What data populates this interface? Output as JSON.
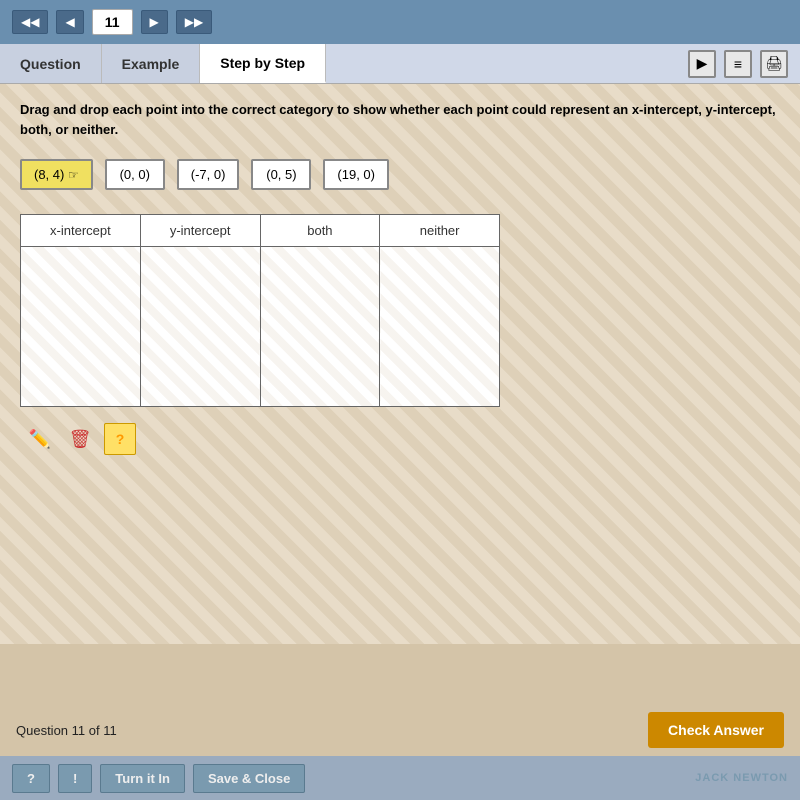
{
  "nav": {
    "back_double_label": "◀◀",
    "back_label": "◀",
    "question_number": "11",
    "forward_label": "▶",
    "forward_double_label": "▶▶"
  },
  "tabs": [
    {
      "id": "question",
      "label": "Question",
      "active": false
    },
    {
      "id": "example",
      "label": "Example",
      "active": false
    },
    {
      "id": "stepbystep",
      "label": "Step by Step",
      "active": true
    }
  ],
  "tab_icons": [
    {
      "id": "play",
      "symbol": "▶"
    },
    {
      "id": "book",
      "symbol": "📖"
    },
    {
      "id": "print",
      "symbol": "🖨"
    }
  ],
  "instructions": "Drag and drop each point into the correct category to show whether each point could represent an x-intercept, y-intercept, both, or neither.",
  "points": [
    {
      "id": "p1",
      "label": "(8, 4)",
      "selected": true
    },
    {
      "id": "p2",
      "label": "(0, 0)",
      "selected": false
    },
    {
      "id": "p3",
      "label": "(-7, 0)",
      "selected": false
    },
    {
      "id": "p4",
      "label": "(0, 5)",
      "selected": false
    },
    {
      "id": "p5",
      "label": "(19, 0)",
      "selected": false
    }
  ],
  "drop_columns": [
    {
      "id": "x-intercept",
      "label": "x-intercept"
    },
    {
      "id": "y-intercept",
      "label": "y-intercept"
    },
    {
      "id": "both",
      "label": "both"
    },
    {
      "id": "neither",
      "label": "neither"
    }
  ],
  "tools": [
    {
      "id": "pencil",
      "symbol": "✏️",
      "name": "pencil-tool"
    },
    {
      "id": "trash",
      "symbol": "🗑",
      "name": "trash-tool"
    },
    {
      "id": "help",
      "symbol": "?",
      "name": "help-tool"
    }
  ],
  "status": {
    "question_count_label": "Question 11 of 11",
    "check_answer_label": "Check Answer"
  },
  "footer": {
    "btn1_label": "?",
    "btn2_label": "!",
    "btn3_label": "Turn it In",
    "btn4_label": "Save & Close"
  },
  "watermark": "JACK NEWTON"
}
